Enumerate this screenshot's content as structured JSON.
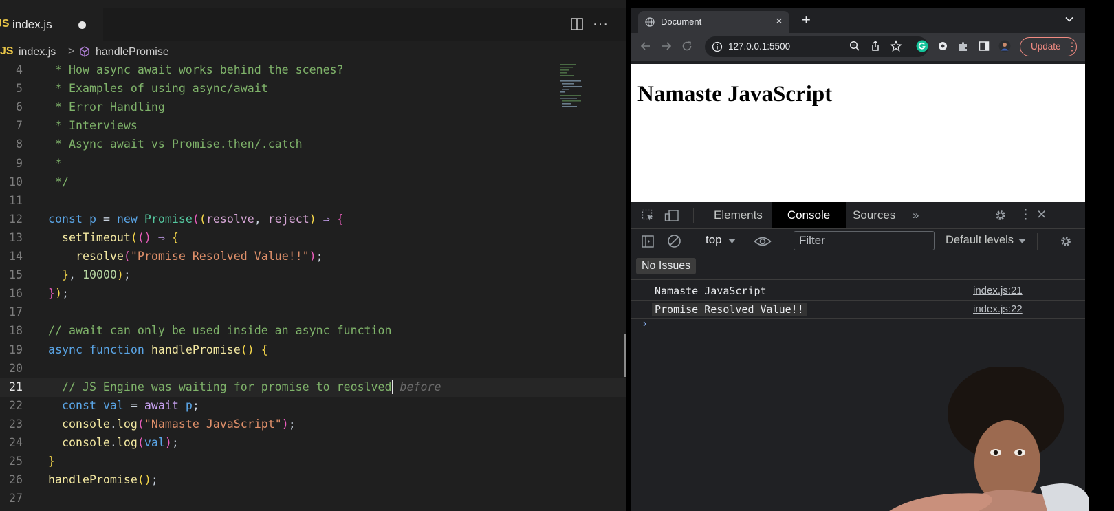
{
  "editor": {
    "tab": {
      "badge": "JS",
      "filename": "index.js"
    },
    "breadcrumb": {
      "badge": "JS",
      "file": "index.js",
      "separator": ">",
      "symbol": "handlePromise"
    },
    "lines": [
      {
        "n": "4",
        "segs": [
          [
            "c-com",
            " * How async await works behind the scenes?"
          ]
        ]
      },
      {
        "n": "5",
        "segs": [
          [
            "c-com",
            " * Examples of using async/await"
          ]
        ]
      },
      {
        "n": "6",
        "segs": [
          [
            "c-com",
            " * Error Handling"
          ]
        ]
      },
      {
        "n": "7",
        "segs": [
          [
            "c-com",
            " * Interviews"
          ]
        ]
      },
      {
        "n": "8",
        "segs": [
          [
            "c-com",
            " * Async await vs Promise.then/.catch"
          ]
        ]
      },
      {
        "n": "9",
        "segs": [
          [
            "c-com",
            " *"
          ]
        ]
      },
      {
        "n": "10",
        "segs": [
          [
            "c-com",
            " */"
          ]
        ]
      },
      {
        "n": "11",
        "segs": []
      },
      {
        "n": "12",
        "segs": [
          [
            "c-kw",
            "const"
          ],
          [
            "c-def",
            " "
          ],
          [
            "c-kw",
            "p"
          ],
          [
            "c-def",
            " = "
          ],
          [
            "c-kw",
            "new"
          ],
          [
            "c-def",
            " "
          ],
          [
            "c-cls",
            "Promise"
          ],
          [
            "c-par",
            "("
          ],
          [
            "c-brc",
            "("
          ],
          [
            "c-prm",
            "resolve"
          ],
          [
            "c-def",
            ", "
          ],
          [
            "c-prm",
            "reject"
          ],
          [
            "c-brc",
            ")"
          ],
          [
            "c-def",
            " "
          ],
          [
            "c-op",
            "⇒"
          ],
          [
            "c-def",
            " "
          ],
          [
            "c-par",
            "{"
          ]
        ]
      },
      {
        "n": "13",
        "segs": [
          [
            "c-def",
            "  "
          ],
          [
            "c-fn",
            "setTimeout"
          ],
          [
            "c-brc",
            "("
          ],
          [
            "c-par",
            "()"
          ],
          [
            "c-def",
            " "
          ],
          [
            "c-op",
            "⇒"
          ],
          [
            "c-def",
            " "
          ],
          [
            "c-brc",
            "{"
          ]
        ]
      },
      {
        "n": "14",
        "segs": [
          [
            "c-def",
            "    "
          ],
          [
            "c-fn",
            "resolve"
          ],
          [
            "c-par",
            "("
          ],
          [
            "c-str",
            "\"Promise Resolved Value!!\""
          ],
          [
            "c-par",
            ")"
          ],
          [
            "c-def",
            ";"
          ]
        ]
      },
      {
        "n": "15",
        "segs": [
          [
            "c-def",
            "  "
          ],
          [
            "c-brc",
            "}"
          ],
          [
            "c-def",
            ", "
          ],
          [
            "c-num",
            "10000"
          ],
          [
            "c-brc",
            ")"
          ],
          [
            "c-def",
            ";"
          ]
        ]
      },
      {
        "n": "16",
        "segs": [
          [
            "c-par",
            "}"
          ],
          [
            "c-brc",
            ")"
          ],
          [
            "c-def",
            ";"
          ]
        ]
      },
      {
        "n": "17",
        "segs": []
      },
      {
        "n": "18",
        "segs": [
          [
            "c-com",
            "// await can only be used inside an async function"
          ]
        ]
      },
      {
        "n": "19",
        "segs": [
          [
            "c-kw",
            "async"
          ],
          [
            "c-def",
            " "
          ],
          [
            "c-kw",
            "function"
          ],
          [
            "c-def",
            " "
          ],
          [
            "c-fn",
            "handlePromise"
          ],
          [
            "c-brc",
            "()"
          ],
          [
            "c-def",
            " "
          ],
          [
            "c-brc",
            "{"
          ]
        ]
      },
      {
        "n": "20",
        "segs": []
      },
      {
        "n": "21",
        "active": true,
        "segs": [
          [
            "c-com",
            "  // JS Engine was waiting for promise to reoslved"
          ],
          [
            "caret",
            ""
          ],
          [
            "ghost",
            " before"
          ]
        ]
      },
      {
        "n": "22",
        "segs": [
          [
            "c-def",
            "  "
          ],
          [
            "c-kw",
            "const"
          ],
          [
            "c-def",
            " "
          ],
          [
            "c-kw",
            "val"
          ],
          [
            "c-def",
            " = "
          ],
          [
            "c-op",
            "await"
          ],
          [
            "c-def",
            " "
          ],
          [
            "c-kw",
            "p"
          ],
          [
            "c-def",
            ";"
          ]
        ]
      },
      {
        "n": "23",
        "segs": [
          [
            "c-def",
            "  "
          ],
          [
            "c-fn",
            "console"
          ],
          [
            "c-def",
            "."
          ],
          [
            "c-fn",
            "log"
          ],
          [
            "c-par",
            "("
          ],
          [
            "c-str",
            "\"Namaste JavaScript\""
          ],
          [
            "c-par",
            ")"
          ],
          [
            "c-def",
            ";"
          ]
        ]
      },
      {
        "n": "24",
        "segs": [
          [
            "c-def",
            "  "
          ],
          [
            "c-fn",
            "console"
          ],
          [
            "c-def",
            "."
          ],
          [
            "c-fn",
            "log"
          ],
          [
            "c-par",
            "("
          ],
          [
            "c-kw",
            "val"
          ],
          [
            "c-par",
            ")"
          ],
          [
            "c-def",
            ";"
          ]
        ]
      },
      {
        "n": "25",
        "segs": [
          [
            "c-brc",
            "}"
          ]
        ]
      },
      {
        "n": "26",
        "segs": [
          [
            "c-fn",
            "handlePromise"
          ],
          [
            "c-brc",
            "()"
          ],
          [
            "c-def",
            ";"
          ]
        ]
      },
      {
        "n": "27",
        "segs": []
      }
    ]
  },
  "browser": {
    "tab_title": "Document",
    "url": "127.0.0.1:5500",
    "update_label": "Update",
    "page_heading": "Namaste JavaScript",
    "devtools": {
      "tabs": {
        "elements": "Elements",
        "console": "Console",
        "sources": "Sources",
        "more": "»"
      },
      "context": "top",
      "filter_placeholder": "Filter",
      "levels": "Default levels",
      "issues": "No Issues",
      "logs": [
        {
          "message": "Namaste JavaScript",
          "source": "index.js:21"
        },
        {
          "message": "Promise Resolved Value!!",
          "source": "index.js:22"
        }
      ],
      "prompt": "›"
    }
  },
  "colors": {
    "editor_bg": "#1f1f1f",
    "devtools_bg": "#202124",
    "update_accent": "#f28b82"
  },
  "icons": [
    "split-editor-icon",
    "more-actions-icon",
    "symbol-method-icon",
    "globe-icon",
    "close-icon",
    "new-tab-icon",
    "back-icon",
    "forward-icon",
    "reload-icon",
    "info-icon",
    "zoom-icon",
    "share-icon",
    "star-icon",
    "grammarly-icon",
    "extension-icon",
    "puzzle-icon",
    "sidepanel-icon",
    "profile-avatar",
    "inspect-icon",
    "device-toolbar-icon",
    "settings-gear-icon",
    "kebab-menu-icon",
    "sidebar-toggle-icon",
    "clear-console-icon",
    "eye-icon"
  ]
}
